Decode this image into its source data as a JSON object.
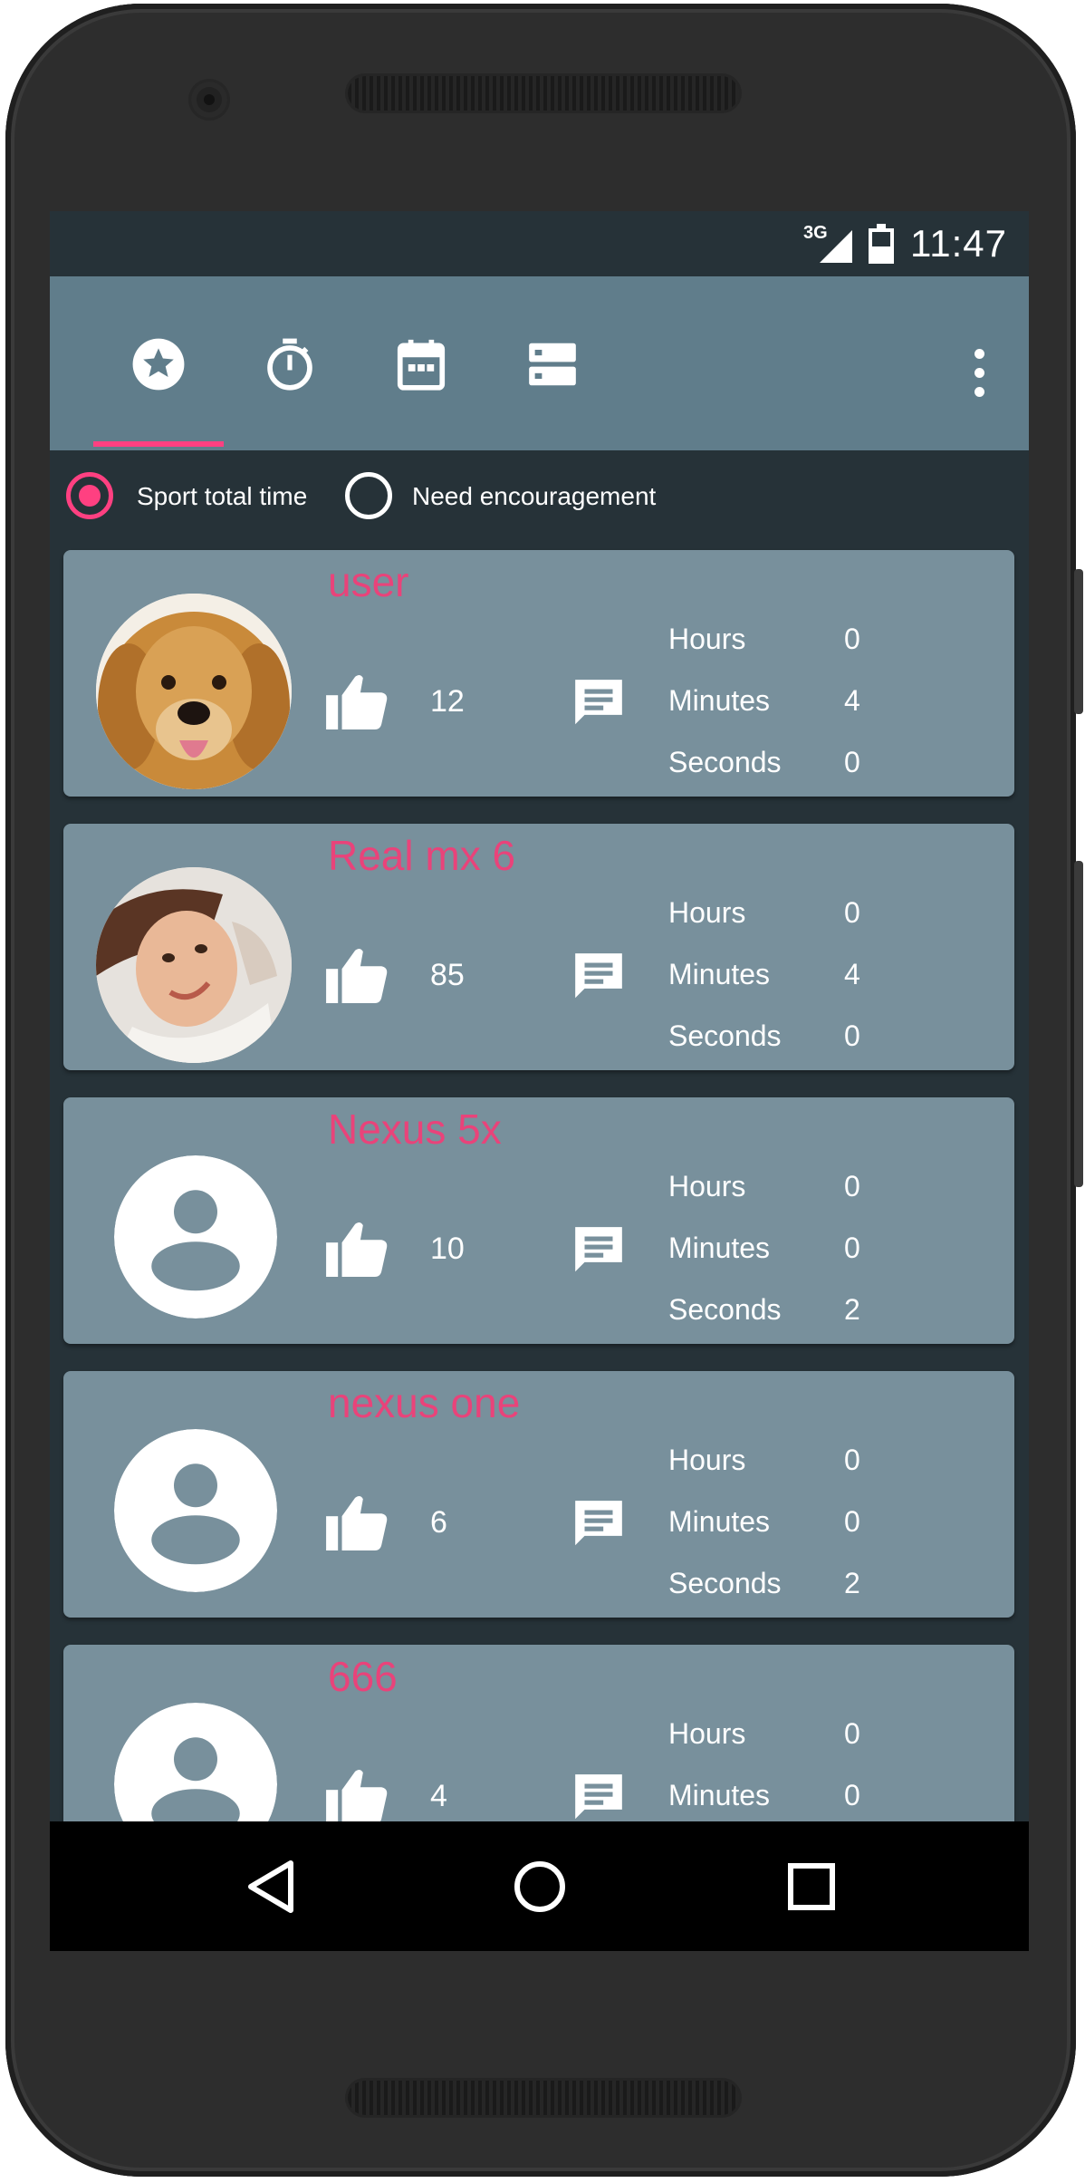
{
  "status_bar": {
    "network": "3G",
    "time": "11:47"
  },
  "app_bar": {
    "tabs": [
      {
        "icon": "star-circle-icon",
        "selected": true
      },
      {
        "icon": "timer-icon",
        "selected": false
      },
      {
        "icon": "calendar-icon",
        "selected": false
      },
      {
        "icon": "storage-icon",
        "selected": false
      }
    ],
    "overflow_icon": "more-vert-icon",
    "accent_color": "#ff4081",
    "toolbar_color": "#607d8b"
  },
  "filter": {
    "options": [
      {
        "label": "Sport total time",
        "selected": true
      },
      {
        "label": "Need encouragement",
        "selected": false
      }
    ]
  },
  "labels": {
    "hours": "Hours",
    "minutes": "Minutes",
    "seconds": "Seconds"
  },
  "users": [
    {
      "name": "user",
      "avatar": "dog-photo",
      "likes": "12",
      "hours": "0",
      "minutes": "4",
      "seconds": "0"
    },
    {
      "name": "Real mx 6",
      "avatar": "person-photo",
      "likes": "85",
      "hours": "0",
      "minutes": "4",
      "seconds": "0"
    },
    {
      "name": "Nexus 5x",
      "avatar": "default-avatar-icon",
      "likes": "10",
      "hours": "0",
      "minutes": "0",
      "seconds": "2"
    },
    {
      "name": "nexus one",
      "avatar": "default-avatar-icon",
      "likes": "6",
      "hours": "0",
      "minutes": "0",
      "seconds": "2"
    },
    {
      "name": "666",
      "avatar": "default-avatar-icon",
      "likes": "4",
      "hours": "0",
      "minutes": "0",
      "seconds": ""
    }
  ],
  "nav_bar": {
    "buttons": [
      "back-icon",
      "home-icon",
      "recents-icon"
    ]
  }
}
